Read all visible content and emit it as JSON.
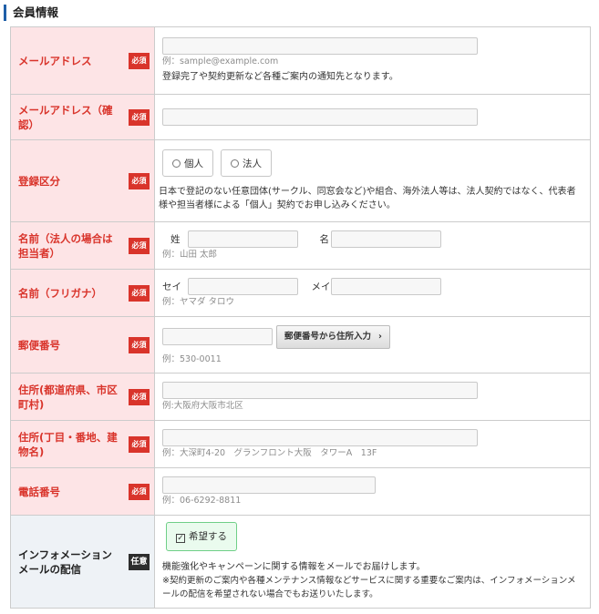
{
  "section": {
    "title": "会員情報"
  },
  "badges": {
    "required": "必須",
    "optional": "任意"
  },
  "email": {
    "label": "メールアドレス",
    "hint": "例：sample@example.com",
    "note": "登録完了や契約更新など各種ご案内の通知先となります。"
  },
  "email_confirm": {
    "label": "メールアドレス（確認）"
  },
  "reg_type": {
    "label": "登録区分",
    "option_individual": "個人",
    "option_corporate": "法人",
    "note": "日本で登記のない任意団体(サークル、同窓会など)や組合、海外法人等は、法人契約ではなく、代表者様や担当者様による「個人」契約でお申し込みください。"
  },
  "name": {
    "label": "名前（法人の場合は担当者）",
    "last": "姓",
    "first": "名",
    "hint": "例：山田 太郎"
  },
  "kana": {
    "label": "名前（フリガナ）",
    "last": "セイ",
    "first": "メイ",
    "hint": "例：ヤマダ タロウ"
  },
  "zip": {
    "label": "郵便番号",
    "button": "郵便番号から住所入力",
    "chevron": "›",
    "hint": "例：530-0011"
  },
  "addr1": {
    "label": "住所(都道府県、市区町村)",
    "hint": "例:大阪府大阪市北区"
  },
  "addr2": {
    "label": "住所(丁目・番地、建物名)",
    "hint": "例：大深町4-20　グランフロント大阪　タワーA　13F"
  },
  "phone": {
    "label": "電話番号",
    "hint": "例：06-6292-8811"
  },
  "info_mail": {
    "label": "インフォメーションメールの配信",
    "checkbox": "希望する",
    "check_mark": "✓",
    "note1": "機能強化やキャンペーンに関する情報をメールでお届けします。",
    "note2": "※契約更新のご案内や各種メンテナンス情報などサービスに関する重要なご案内は、インフォメーションメールの配信を希望されない場合でもお送りいたします。"
  }
}
